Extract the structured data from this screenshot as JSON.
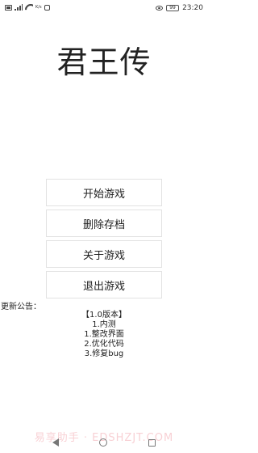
{
  "status_bar": {
    "network_speed": "K/s",
    "battery": "99",
    "time": "23:20"
  },
  "app": {
    "title": "君王传"
  },
  "menu": {
    "start": "开始游戏",
    "delete": "删除存档",
    "about": "关于游戏",
    "exit": "退出游戏"
  },
  "notice": {
    "label": "更新公告：",
    "lines": [
      "【1.0版本】",
      "1.内测",
      "1.整改界面",
      "2.优化代码",
      "3.修复bug"
    ]
  },
  "watermark": "易享助手 · EDSHZJT.COM",
  "icons": [
    "sim-icon",
    "signal-icon",
    "wifi-icon",
    "message-icon",
    "eye-icon",
    "battery-icon",
    "back-icon",
    "home-icon",
    "recents-icon"
  ]
}
